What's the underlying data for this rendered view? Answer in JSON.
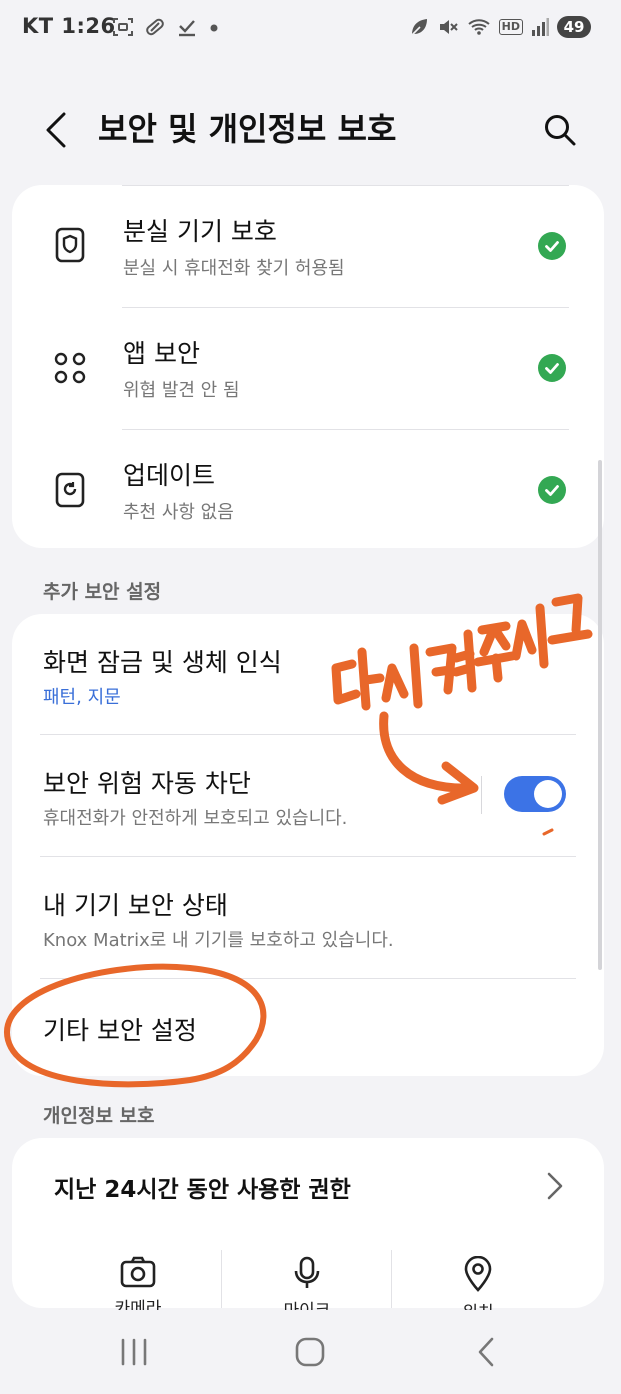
{
  "status_bar": {
    "carrier": "KT",
    "time": "1:26",
    "battery": "49",
    "hd_label": "HD",
    "left_icons": [
      "screenshot-icon",
      "pill-icon",
      "download-done-icon",
      "dot-icon"
    ],
    "right_icons": [
      "leaf-icon",
      "mute-icon",
      "wifi-icon",
      "hd-icon",
      "signal-icon"
    ]
  },
  "header": {
    "title": "보안 및 개인정보 보호"
  },
  "security_status": [
    {
      "title": "분실 기기 보호",
      "subtitle": "분실 시 휴대전화 찾기 허용됨",
      "icon": "shield-icon"
    },
    {
      "title": "앱 보안",
      "subtitle": "위협 발견 안 됨",
      "icon": "apps-icon"
    },
    {
      "title": "업데이트",
      "subtitle": "추천 사항 없음",
      "icon": "update-icon"
    }
  ],
  "additional_section": {
    "label": "추가 보안 설정",
    "items": [
      {
        "title": "화면 잠금 및 생체 인식",
        "subtitle": "패턴, 지문"
      },
      {
        "title": "보안 위험 자동 차단",
        "subtitle": "휴대전화가 안전하게 보호되고 있습니다.",
        "toggle_on": true
      },
      {
        "title": "내 기기 보안 상태",
        "subtitle": "Knox Matrix로 내 기기를 보호하고 있습니다."
      },
      {
        "title": "기타 보안 설정",
        "subtitle": ""
      }
    ]
  },
  "privacy_section": {
    "label": "개인정보 보호",
    "permission_title": "지난 24시간 동안 사용한 권한",
    "permissions": [
      {
        "label": "카메라",
        "icon": "camera-icon"
      },
      {
        "label": "마이크",
        "icon": "microphone-icon"
      },
      {
        "label": "위치",
        "icon": "location-icon"
      }
    ]
  },
  "annotation": {
    "handwritten_text": "다시 켜주시고",
    "color": "#e8672a"
  },
  "colors": {
    "background": "#f3f3f6",
    "card": "#ffffff",
    "check_green": "#33a853",
    "toggle_blue": "#3c73e6",
    "link_blue": "#3a6fd8"
  }
}
